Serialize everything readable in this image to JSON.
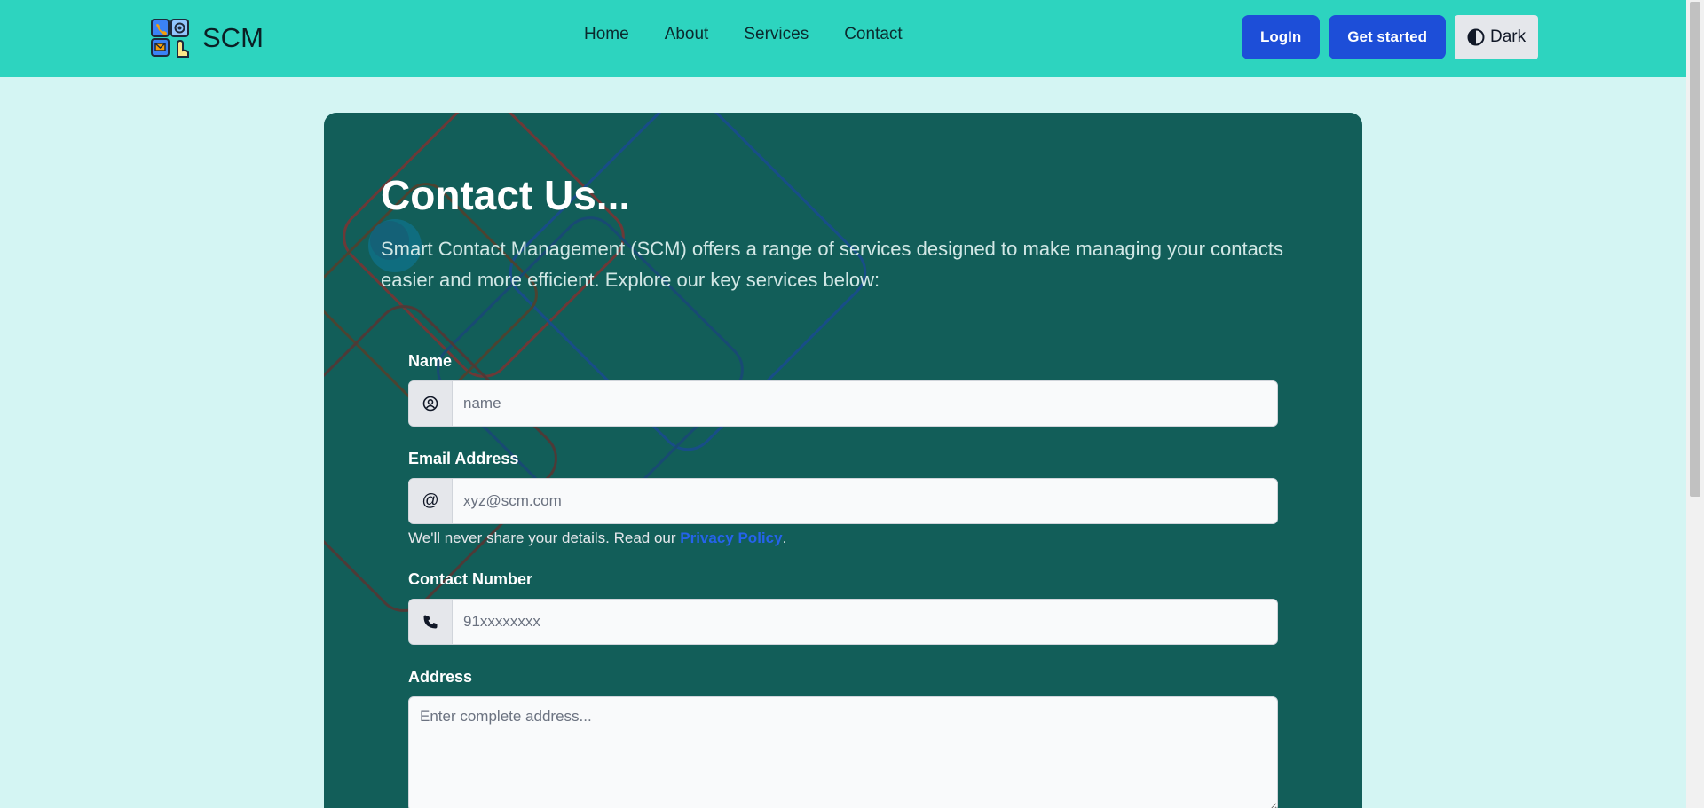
{
  "navbar": {
    "brand": "SCM",
    "links": [
      "Home",
      "About",
      "Services",
      "Contact"
    ],
    "login_label": "LogIn",
    "get_started_label": "Get started",
    "theme_toggle_label": "Dark",
    "background_color": "#2dd4bf"
  },
  "contact": {
    "title": "Contact Us...",
    "description": "Smart Contact Management (SCM) offers a range of services designed to make managing your contacts easier and more efficient. Explore our key services below:",
    "card_color": "#125e59",
    "fields": {
      "name": {
        "label": "Name",
        "placeholder": "name",
        "icon": "user-circle-icon"
      },
      "email": {
        "label": "Email Address",
        "placeholder": "xyz@scm.com",
        "icon": "at-sign-icon"
      },
      "phone": {
        "label": "Contact Number",
        "placeholder": "91xxxxxxxx",
        "icon": "phone-icon"
      },
      "address": {
        "label": "Address",
        "placeholder": "Enter complete address..."
      }
    },
    "privacy_note_prefix": "We'll never share your details. Read our ",
    "privacy_link": "Privacy Policy",
    "privacy_note_suffix": "."
  },
  "colors": {
    "page_background": "#d4f5f3",
    "primary_button": "#1d4ed8",
    "link": "#2563eb"
  }
}
